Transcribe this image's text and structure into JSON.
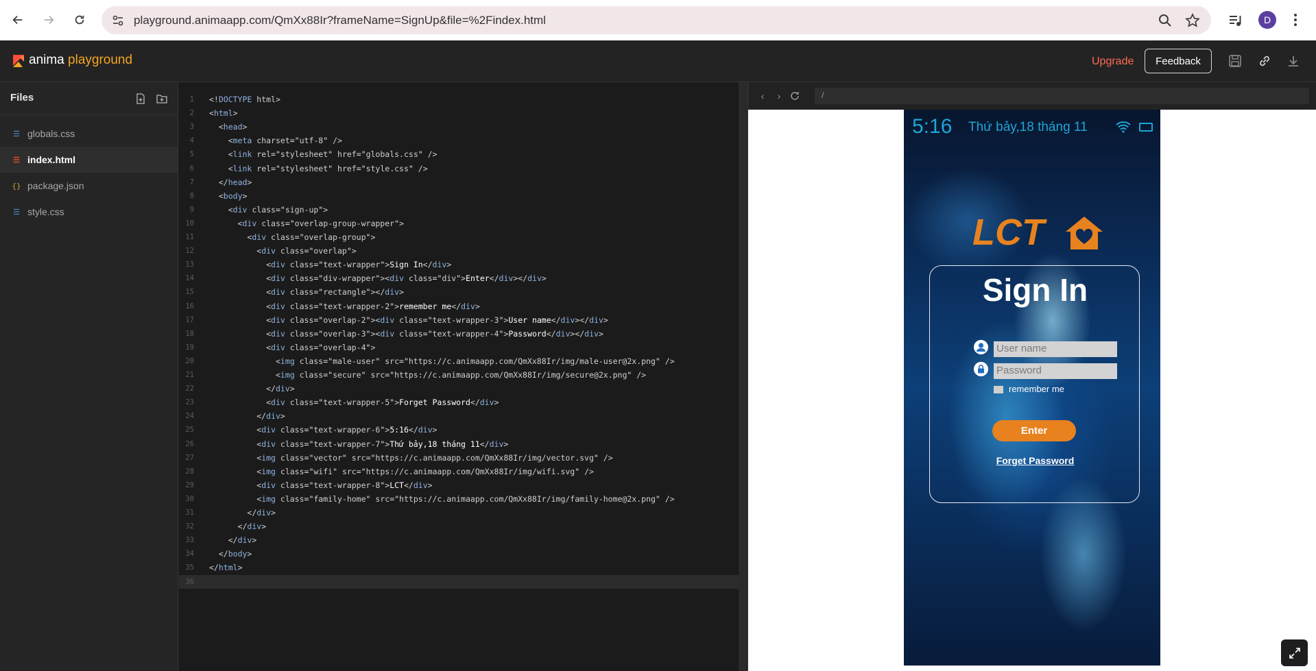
{
  "browser": {
    "url": "playground.animaapp.com/QmXx88Ir?frameName=SignUp&file=%2Findex.html",
    "profile_initial": "D"
  },
  "app": {
    "logo_word": "anima",
    "logo_product": "playground",
    "upgrade_label": "Upgrade",
    "feedback_label": "Feedback"
  },
  "sidebar": {
    "title": "Files",
    "files": [
      {
        "name": "globals.css",
        "type": "css"
      },
      {
        "name": "index.html",
        "type": "html",
        "active": true
      },
      {
        "name": "package.json",
        "type": "json"
      },
      {
        "name": "style.css",
        "type": "css"
      }
    ]
  },
  "editor": {
    "current_line": 36,
    "lines": [
      "<!DOCTYPE html>",
      "<html>",
      "  <head>",
      "    <meta charset=\"utf-8\" />",
      "    <link rel=\"stylesheet\" href=\"globals.css\" />",
      "    <link rel=\"stylesheet\" href=\"style.css\" />",
      "  </head>",
      "  <body>",
      "    <div class=\"sign-up\">",
      "      <div class=\"overlap-group-wrapper\">",
      "        <div class=\"overlap-group\">",
      "          <div class=\"overlap\">",
      "            <div class=\"text-wrapper\">Sign In</div>",
      "            <div class=\"div-wrapper\"><div class=\"div\">Enter</div></div>",
      "            <div class=\"rectangle\"></div>",
      "            <div class=\"text-wrapper-2\">remember me</div>",
      "            <div class=\"overlap-2\"><div class=\"text-wrapper-3\">User name</div></div>",
      "            <div class=\"overlap-3\"><div class=\"text-wrapper-4\">Password</div></div>",
      "            <div class=\"overlap-4\">",
      "              <img class=\"male-user\" src=\"https://c.animaapp.com/QmXx88Ir/img/male-user@2x.png\" />",
      "              <img class=\"secure\" src=\"https://c.animaapp.com/QmXx88Ir/img/secure@2x.png\" />",
      "            </div>",
      "            <div class=\"text-wrapper-5\">Forget Password</div>",
      "          </div>",
      "          <div class=\"text-wrapper-6\">5:16</div>",
      "          <div class=\"text-wrapper-7\">Thứ bảy,18 tháng 11</div>",
      "          <img class=\"vector\" src=\"https://c.animaapp.com/QmXx88Ir/img/vector.svg\" />",
      "          <img class=\"wifi\" src=\"https://c.animaapp.com/QmXx88Ir/img/wifi.svg\" />",
      "          <div class=\"text-wrapper-8\">LCT</div>",
      "          <img class=\"family-home\" src=\"https://c.animaapp.com/QmXx88Ir/img/family-home@2x.png\" />",
      "        </div>",
      "      </div>",
      "    </div>",
      "  </body>",
      "</html>",
      ""
    ]
  },
  "preview": {
    "path": "/",
    "phone": {
      "time": "5:16",
      "date": "Thứ bảy,18 tháng 11",
      "brand": "LCT",
      "title": "Sign In",
      "username_placeholder": "User name",
      "password_placeholder": "Password",
      "remember_label": "remember me",
      "enter_label": "Enter",
      "forget_label": "Forget Password"
    }
  },
  "colors": {
    "accent_orange": "#e8821f",
    "status_blue": "#1fa5d6",
    "upgrade_red": "#ff6a55",
    "logo_yellow": "#f5a623"
  }
}
